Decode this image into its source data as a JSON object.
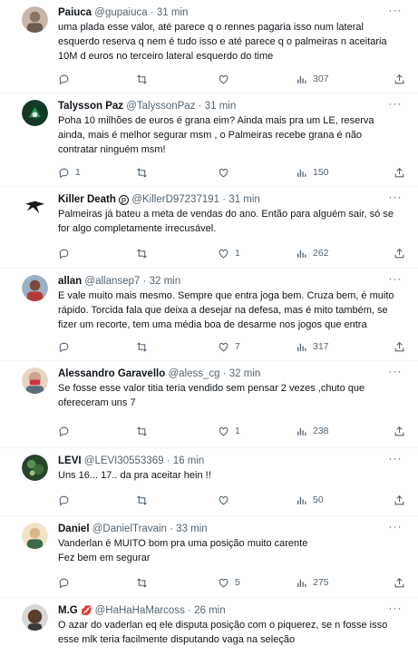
{
  "tweets": [
    {
      "name": "Paiuca",
      "handle": "@gupaiuca",
      "time": "31 min",
      "text": "uma plada esse valor, até parece q o rennes pagaria isso num lateral\nesquerdo reserva q nem é tudo isso e até parece q o palmeiras n aceitaria\n10M d euros no terceiro lateral esquerdo do time",
      "replies": "",
      "retweets": "",
      "likes": "",
      "views": "307",
      "avatar_color": "#8a7566"
    },
    {
      "name": "Talysson Paz",
      "handle": "@TalyssonPaz",
      "time": "31 min",
      "text": "Poha 10 milhões de euros é grana eim? Ainda mais pra um LE, reserva\nainda, mais é melhor segurar msm , o Palmeiras recebe grana é não\ncontratar ninguém msm!",
      "replies": "1",
      "retweets": "",
      "likes": "",
      "views": "150",
      "avatar_color": "#1f5f3b"
    },
    {
      "name": "Killer Death",
      "handle": "@KillerD97237191",
      "time": "31 min",
      "text": "Palmeiras já bateu a meta de vendas do ano. Então para alguém sair, só se\nfor algo completamente irrecusável.",
      "replies": "",
      "retweets": "",
      "likes": "1",
      "views": "262",
      "avatar_color": "#ffffff"
    },
    {
      "name": "allan",
      "handle": "@allansep7",
      "time": "32 min",
      "text": "E vale muito mais mesmo. Sempre que entra joga bem. Cruza bem, é muito\nrápido. Torcida fala que deixa a desejar na defesa, mas é mito também, se\nfizer um recorte, tem uma média boa de desarme nos jogos que entra",
      "replies": "",
      "retweets": "",
      "likes": "7",
      "views": "317",
      "avatar_color": "#7a4a3a"
    },
    {
      "name": "Alessandro Garavello",
      "handle": "@aless_cg",
      "time": "32 min",
      "text": "Se fosse esse valor titia teria vendido sem pensar 2 vezes ,chuto que\nofereceram uns 7",
      "replies": "",
      "retweets": "",
      "likes": "1",
      "views": "238",
      "avatar_color": "#c9a48e"
    },
    {
      "name": "LEVI",
      "handle": "@LEVI30553369",
      "time": "16 min",
      "text": "Uns 16... 17.. da pra aceitar hein !!",
      "replies": "",
      "retweets": "",
      "likes": "",
      "views": "50",
      "avatar_color": "#3e6b3c"
    },
    {
      "name": "Daniel",
      "handle": "@DanielTravain",
      "time": "33 min",
      "text": "Vanderlan é MUITO bom pra uma posição muito carente\nFez bem em segurar",
      "replies": "",
      "retweets": "",
      "likes": "5",
      "views": "275",
      "avatar_color": "#d9b98a"
    },
    {
      "name": "M.G",
      "handle": "@HaHaHaMarcoss",
      "time": "26 min",
      "text": "O azar do vaderlan eq ele disputa posição com o piquerez, se n fosse isso\nesse mlk teria facilmente disputando vaga na seleção",
      "replies": "",
      "retweets": "",
      "likes": "",
      "views": "",
      "avatar_color": "#5a3d2e"
    }
  ],
  "icons": {
    "more": "more-icon",
    "reply": "reply-icon",
    "retweet": "retweet-icon",
    "like": "like-icon",
    "views": "views-icon",
    "share": "share-icon"
  },
  "colors": {
    "text": "#0f1419",
    "muted": "#536471",
    "divider": "#eff3f4",
    "hearts": "#e0245e"
  },
  "badges": {
    "killer_death": "ℙ",
    "mg_hearts": "💋"
  }
}
